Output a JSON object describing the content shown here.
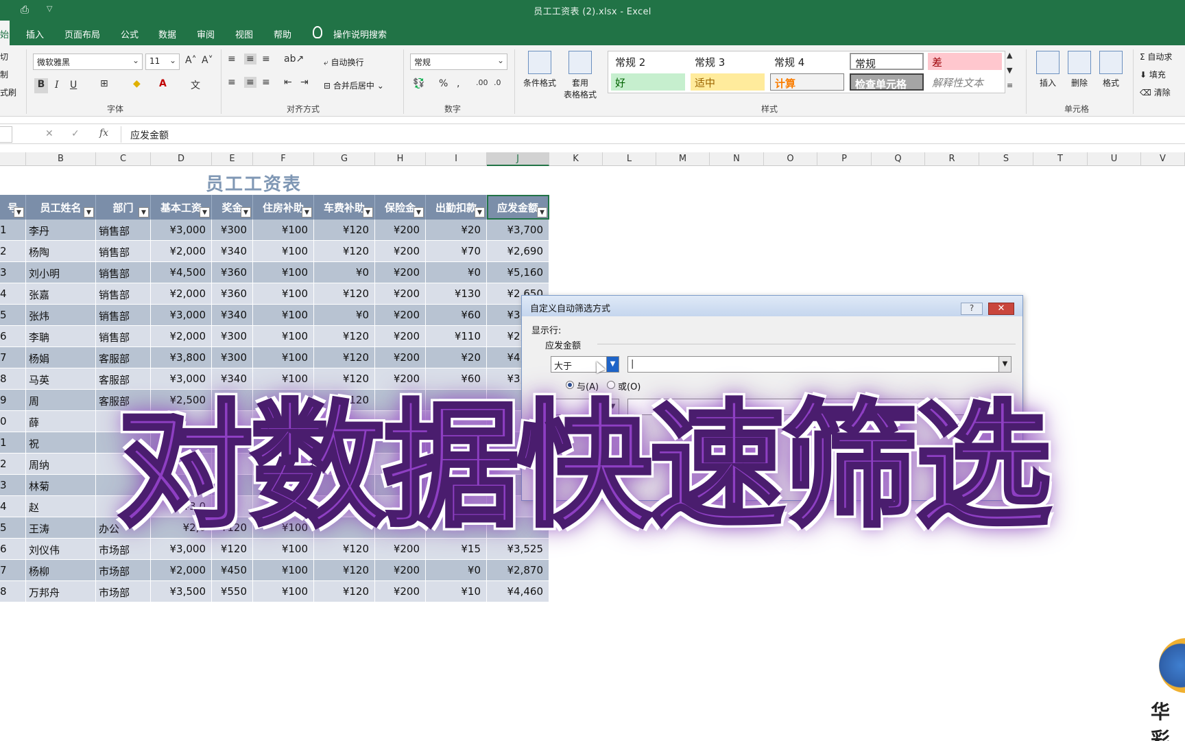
{
  "window": {
    "title": "员工工资表 (2).xlsx  -  Excel"
  },
  "tabs": [
    {
      "label": "始",
      "active": true
    },
    {
      "label": "插入"
    },
    {
      "label": "页面布局"
    },
    {
      "label": "公式"
    },
    {
      "label": "数据"
    },
    {
      "label": "审阅"
    },
    {
      "label": "视图"
    },
    {
      "label": "帮助"
    },
    {
      "label": "操作说明搜索"
    }
  ],
  "ribbon": {
    "clipboard_partial": [
      "切",
      "制",
      "式刷"
    ],
    "font_name": "微软雅黑",
    "font_size": "11",
    "auto_wrap": "自动换行",
    "merge_center": "合并后居中",
    "number_format": "常规",
    "cond_format": "条件格式",
    "table_format_1": "套用",
    "table_format_2": "表格格式",
    "styles": {
      "normal2": "常规 2",
      "normal3": "常规 3",
      "normal4": "常规 4",
      "normal": "常规",
      "bad": "差",
      "good": "好",
      "neutral": "适中",
      "calc": "计算",
      "check": "检查单元格",
      "explain": "解释性文本"
    },
    "insert": "插入",
    "delete": "删除",
    "format": "格式",
    "autosum": "自动求",
    "fill": "填充",
    "clear": "清除",
    "groups": {
      "font": "字体",
      "align": "对齐方式",
      "number": "数字",
      "styles": "样式",
      "cells": "单元格"
    }
  },
  "formula_bar": {
    "content": "应发金额"
  },
  "columns": [
    "B",
    "C",
    "D",
    "E",
    "F",
    "G",
    "H",
    "I",
    "J",
    "K",
    "L",
    "M",
    "N",
    "O",
    "P",
    "Q",
    "R",
    "S",
    "T",
    "U",
    "V"
  ],
  "sheet": {
    "title": "员工工资表",
    "headers": [
      "号",
      "员工姓名",
      "部门",
      "基本工资",
      "奖金",
      "住房补助",
      "车费补助",
      "保险金",
      "出勤扣款",
      "应发金额"
    ],
    "rows": [
      [
        "1",
        "李丹",
        "销售部",
        "¥3,000",
        "¥300",
        "¥100",
        "¥120",
        "¥200",
        "¥20",
        "¥3,700"
      ],
      [
        "2",
        "杨陶",
        "销售部",
        "¥2,000",
        "¥340",
        "¥100",
        "¥120",
        "¥200",
        "¥70",
        "¥2,690"
      ],
      [
        "3",
        "刘小明",
        "销售部",
        "¥4,500",
        "¥360",
        "¥100",
        "¥0",
        "¥200",
        "¥0",
        "¥5,160"
      ],
      [
        "4",
        "张嘉",
        "销售部",
        "¥2,000",
        "¥360",
        "¥100",
        "¥120",
        "¥200",
        "¥130",
        "¥2,650"
      ],
      [
        "5",
        "张炜",
        "销售部",
        "¥3,000",
        "¥340",
        "¥100",
        "¥0",
        "¥200",
        "¥60",
        "¥3,580"
      ],
      [
        "6",
        "李聃",
        "销售部",
        "¥2,000",
        "¥300",
        "¥100",
        "¥120",
        "¥200",
        "¥110",
        "¥2,610"
      ],
      [
        "7",
        "杨娟",
        "客服部",
        "¥3,800",
        "¥300",
        "¥100",
        "¥120",
        "¥200",
        "¥20",
        "¥4,500"
      ],
      [
        "8",
        "马英",
        "客服部",
        "¥3,000",
        "¥340",
        "¥100",
        "¥120",
        "¥200",
        "¥60",
        "¥3,500"
      ],
      [
        "9",
        "周",
        "客服部",
        "¥2,500",
        "",
        "",
        "¥120",
        "",
        "",
        ""
      ],
      [
        "0",
        "薛",
        "",
        "",
        "",
        "",
        "",
        "",
        "",
        ""
      ],
      [
        "1",
        "祝",
        "",
        "",
        "",
        "",
        "",
        "",
        "",
        ""
      ],
      [
        "2",
        "周纳",
        "",
        "¥3,0",
        "",
        "",
        "",
        "",
        "",
        ""
      ],
      [
        "3",
        "林菊",
        "",
        "¥2,",
        "",
        "",
        "",
        "",
        "",
        ""
      ],
      [
        "4",
        "赵",
        "",
        "¥3,0",
        "",
        "",
        "",
        "",
        "",
        ""
      ],
      [
        "5",
        "王涛",
        "办公",
        "¥2,0",
        "¥120",
        "¥100",
        "",
        "",
        "",
        ""
      ],
      [
        "6",
        "刘仪伟",
        "市场部",
        "¥3,000",
        "¥120",
        "¥100",
        "¥120",
        "¥200",
        "¥15",
        "¥3,525"
      ],
      [
        "7",
        "杨柳",
        "市场部",
        "¥2,000",
        "¥450",
        "¥100",
        "¥120",
        "¥200",
        "¥0",
        "¥2,870"
      ],
      [
        "8",
        "万邦舟",
        "市场部",
        "¥3,500",
        "¥550",
        "¥100",
        "¥120",
        "¥200",
        "¥10",
        "¥4,460"
      ]
    ]
  },
  "dialog": {
    "title": "自定义自动筛选方式",
    "help": "?",
    "close": "✕",
    "show_rows": "显示行:",
    "field": "应发金额",
    "op1": "大于",
    "value1": "|",
    "and_label": "与(A)",
    "or_label": "或(O)"
  },
  "banner": {
    "text": "对数据快速筛选"
  },
  "logo": {
    "text": "华彩"
  }
}
